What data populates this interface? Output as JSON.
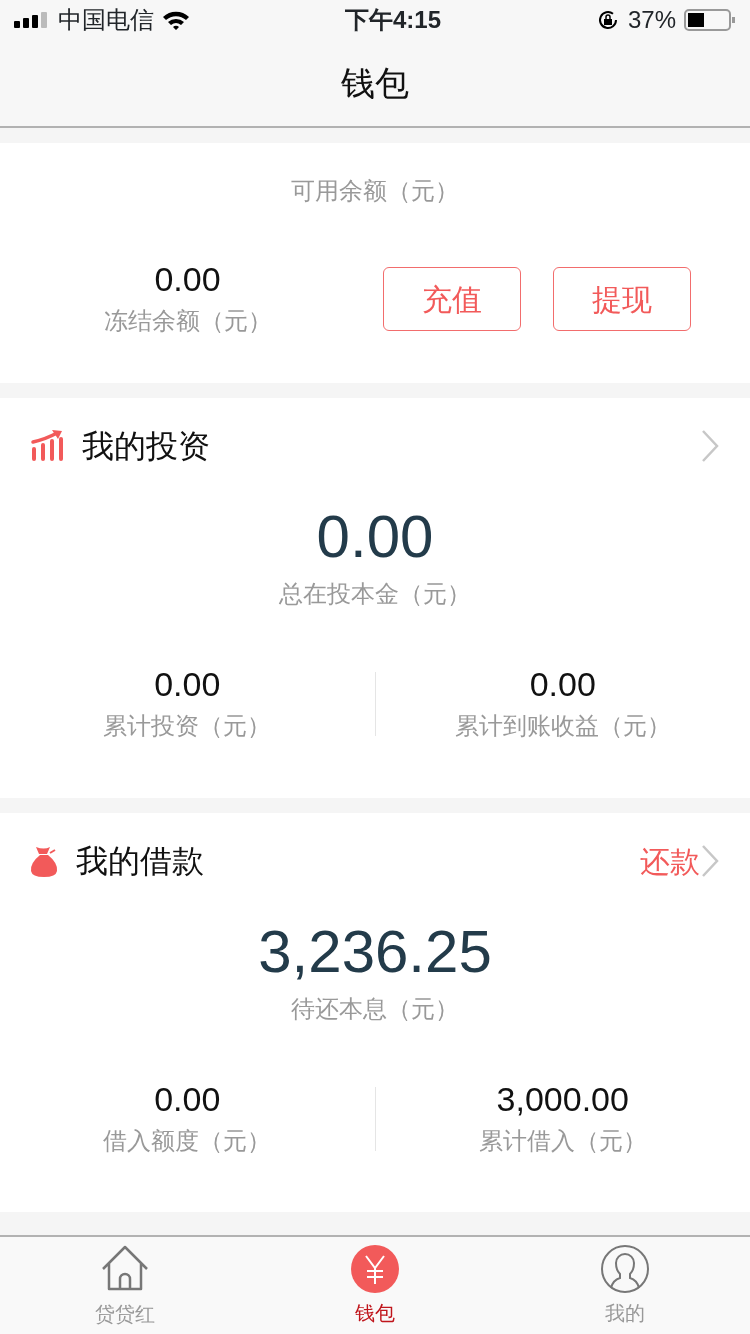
{
  "status_bar": {
    "carrier": "中国电信",
    "time": "下午4:15",
    "battery": "37%"
  },
  "nav": {
    "title": "钱包"
  },
  "balance": {
    "label": "可用余额（元）",
    "frozen": {
      "value": "0.00",
      "label": "冻结余额（元）"
    },
    "buttons": [
      "充值",
      "提现"
    ]
  },
  "sections": [
    {
      "kind": "investment",
      "title": "我的投资",
      "main": {
        "value": "0.00",
        "label": "总在投本金（元）"
      },
      "stats": [
        {
          "value": "0.00",
          "label": "累计投资（元）"
        },
        {
          "value": "0.00",
          "label": "累计到账收益（元）"
        }
      ]
    },
    {
      "kind": "loan",
      "title": "我的借款",
      "action": "还款",
      "main": {
        "value": "3,236.25",
        "label": "待还本息（元）"
      },
      "stats": [
        {
          "value": "0.00",
          "label": "借入额度（元）"
        },
        {
          "value": "3,000.00",
          "label": "累计借入（元）"
        }
      ]
    }
  ],
  "tabs": [
    {
      "kind": "home",
      "label": "贷贷红",
      "selected": false
    },
    {
      "kind": "wallet",
      "label": "钱包",
      "selected": true
    },
    {
      "kind": "profile",
      "label": "我的",
      "selected": false
    }
  ]
}
